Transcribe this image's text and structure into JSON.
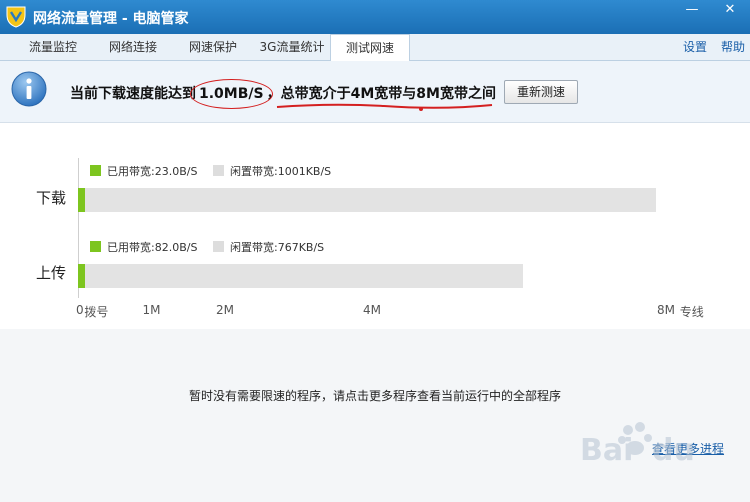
{
  "window": {
    "title": "网络流量管理 - 电脑管家",
    "min_glyph": "—",
    "close_glyph": "✕"
  },
  "tabs": [
    {
      "label": "流量监控"
    },
    {
      "label": "网络连接"
    },
    {
      "label": "网速保护"
    },
    {
      "label": "3G流量统计"
    },
    {
      "label": "测试网速",
      "active": true
    }
  ],
  "top_links": {
    "settings": "设置",
    "help": "帮助"
  },
  "info": {
    "prefix": "当前下载速度能达到",
    "speed": "1.0MB/S",
    "sep": "，",
    "bandwidth": "总带宽介于4M宽带与8M宽带之间",
    "retest_label": "重新测速"
  },
  "chart_data": {
    "type": "bar",
    "orientation": "horizontal",
    "categories": [
      "下载",
      "上传"
    ],
    "series": [
      {
        "name": "已用带宽",
        "legend": [
          "已用带宽:23.0B/S",
          "已用带宽:82.0B/S"
        ],
        "values_mbps": [
          0.05,
          0.05
        ]
      },
      {
        "name": "闲置带宽",
        "legend": [
          "闲置带宽:1001KB/S",
          "闲置带宽:767KB/S"
        ],
        "values_mbps": [
          7.82,
          6.0
        ]
      }
    ],
    "x_ticks": [
      {
        "label": "0",
        "value": 0
      },
      {
        "label": "拨号",
        "value": 0.25
      },
      {
        "label": "1M",
        "value": 1
      },
      {
        "label": "2M",
        "value": 2
      },
      {
        "label": "4M",
        "value": 4
      },
      {
        "label": "8M",
        "value": 8
      },
      {
        "label": "专线",
        "value": 8.35
      }
    ],
    "xlim": [
      0,
      8
    ],
    "grid": false
  },
  "notice": "暂时没有需要限速的程序，请点击更多程序查看当前运行中的全部程序",
  "more_link": "查看更多进程",
  "colors": {
    "accent": "#1b6fb5",
    "used": "#7dc51f",
    "idle": "#e3e3e3",
    "annotation": "#d42020"
  }
}
